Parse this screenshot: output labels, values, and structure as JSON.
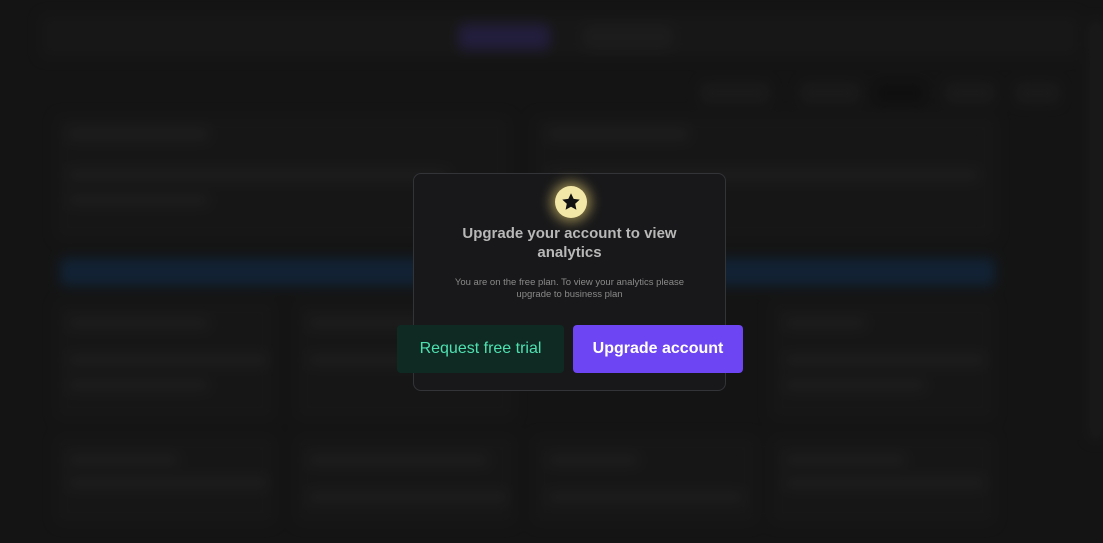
{
  "modal": {
    "icon": "star-icon",
    "title": "Upgrade your account to view analytics",
    "description": "You are on the free plan. To view your analytics please upgrade to business plan",
    "trial_button": "Request free trial",
    "upgrade_button": "Upgrade account"
  },
  "colors": {
    "accent_purple": "#6e45f2",
    "trial_green": "#4fe0b0",
    "star_glow": "#f3e7a8"
  }
}
